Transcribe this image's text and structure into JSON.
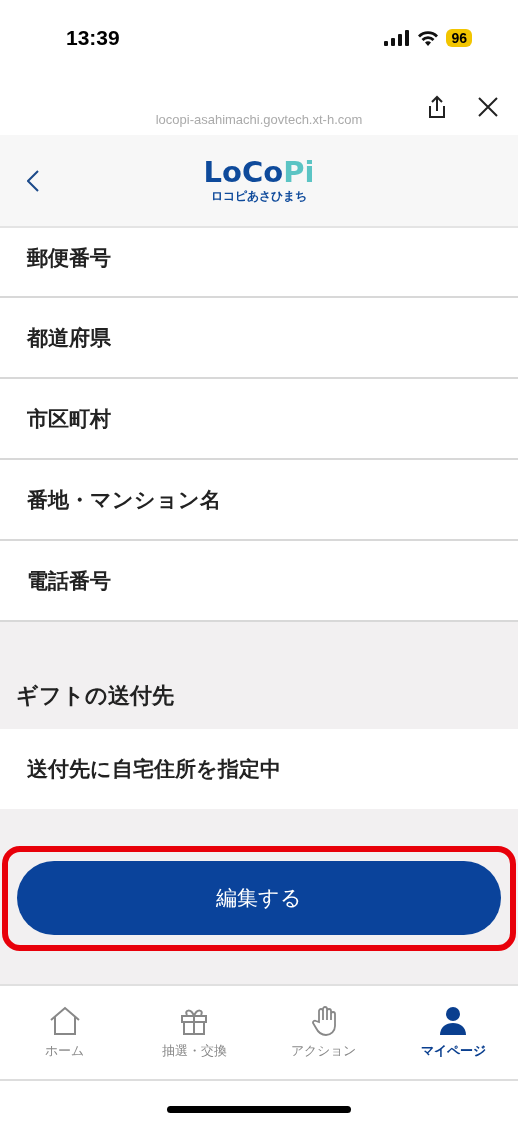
{
  "status_bar": {
    "time": "13:39",
    "battery": "96"
  },
  "browser": {
    "url": "locopi-asahimachi.govtech.xt-h.com"
  },
  "header": {
    "logo_main": "LoCo",
    "logo_accent": "Pi",
    "logo_sub": "ロコピあさひまち"
  },
  "address_rows": [
    {
      "label": "郵便番号"
    },
    {
      "label": "都道府県"
    },
    {
      "label": "市区町村"
    },
    {
      "label": "番地・マンション名"
    },
    {
      "label": "電話番号"
    }
  ],
  "gift_section": {
    "heading": "ギフトの送付先",
    "value": "送付先に自宅住所を指定中"
  },
  "edit_button": {
    "label": "編集する",
    "highlighted": true
  },
  "tab_bar": [
    {
      "label": "ホーム",
      "selected": false
    },
    {
      "label": "抽選・交換",
      "selected": false
    },
    {
      "label": "アクション",
      "selected": false
    },
    {
      "label": "マイページ",
      "selected": true
    }
  ]
}
